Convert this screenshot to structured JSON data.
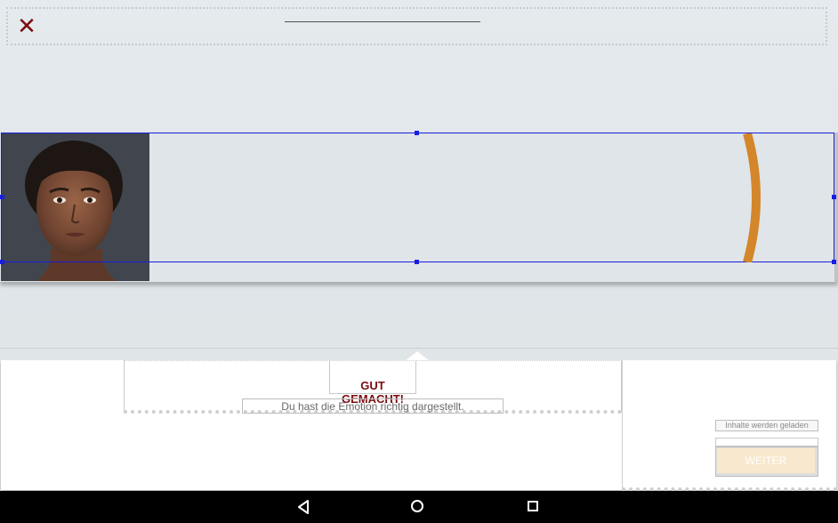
{
  "header": {
    "close_icon_glyph": "✕"
  },
  "feedback": {
    "title": "GUT GEMACHT!",
    "subtitle": "Du hast die Emotion richtig dargestellt."
  },
  "actions": {
    "loading_text": "Inhalte werden geladen",
    "next_button_label": "WEITER"
  },
  "colors": {
    "accent": "#7a0c10",
    "selection": "#1a1ee0",
    "arc": "#d4862a",
    "button_bg": "#f8e8cd"
  },
  "icons": {
    "close": "close-icon",
    "back": "nav-back-icon",
    "home": "nav-home-icon",
    "recent": "nav-recent-icon"
  }
}
